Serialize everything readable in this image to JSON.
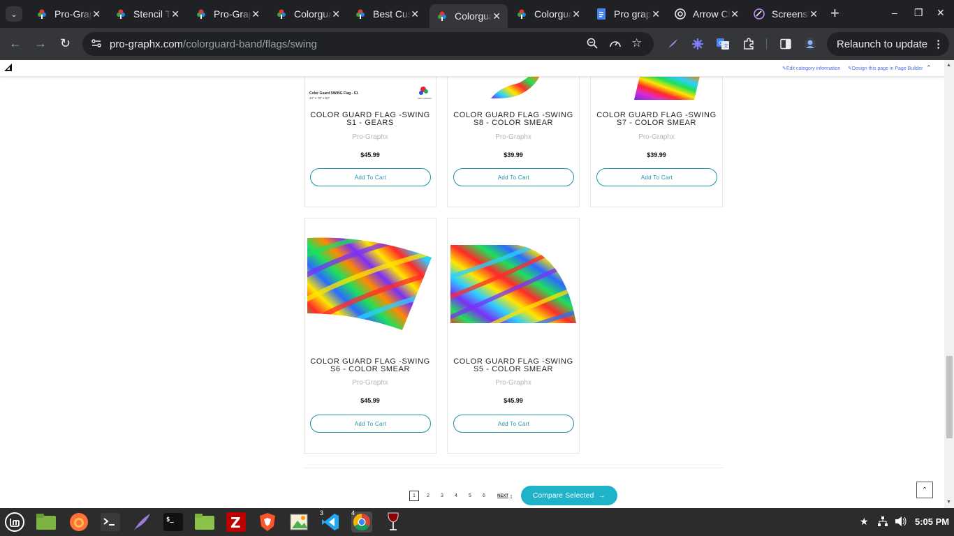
{
  "browser": {
    "tabs": [
      {
        "title": "Pro-Graphx",
        "favicon": "pro-graphx-logo-icon",
        "active": false
      },
      {
        "title": "Stencil Theme",
        "favicon": "pro-graphx-logo-icon",
        "active": false
      },
      {
        "title": "Pro-Graphx",
        "favicon": "pro-graphx-logo-icon",
        "active": false
      },
      {
        "title": "Colorguard",
        "favicon": "pro-graphx-logo-icon",
        "active": false
      },
      {
        "title": "Best Custom",
        "favicon": "pro-graphx-logo-icon",
        "active": false
      },
      {
        "title": "Colorguard",
        "favicon": "pro-graphx-logo-icon",
        "active": true
      },
      {
        "title": "Colorguard",
        "favicon": "pro-graphx-logo-icon",
        "active": false
      },
      {
        "title": "Pro graphx",
        "favicon": "google-docs-icon",
        "active": false
      },
      {
        "title": "Arrow Chat",
        "favicon": "chatgpt-icon",
        "active": false
      },
      {
        "title": "Screenshot",
        "favicon": "screenshot-tool-icon",
        "active": false
      }
    ],
    "url_host": "pro-graphx.com",
    "url_path": "/colorguard-band/flags/swing",
    "relaunch_label": "Relaunch to update"
  },
  "admin_bar": {
    "edit_category": "Edit category information",
    "page_builder": "Design this page in Page Builder"
  },
  "products": [
    {
      "name": "COLOR GUARD FLAG -SWING S1 - GEARS",
      "brand": "Pro-Graphx",
      "price": "$45.99",
      "cart_label": "Add To Cart",
      "image": "flag-s1-gears-image",
      "image_caption_title": "Color Guard SWING Flag - S1",
      "image_caption_size": "44\" x 70\" x 53\"",
      "image_logo_text": "PRO-GRAPHX"
    },
    {
      "name": "COLOR GUARD FLAG -SWING S8 - COLOR SMEAR",
      "brand": "Pro-Graphx",
      "price": "$39.99",
      "cart_label": "Add To Cart",
      "image": "flag-s8-color-smear-image"
    },
    {
      "name": "COLOR GUARD FLAG -SWING S7 - COLOR SMEAR",
      "brand": "Pro-Graphx",
      "price": "$39.99",
      "cart_label": "Add To Cart",
      "image": "flag-s7-color-smear-image"
    },
    {
      "name": "COLOR GUARD FLAG -SWING S6 - COLOR SMEAR",
      "brand": "Pro-Graphx",
      "price": "$45.99",
      "cart_label": "Add To Cart",
      "image": "flag-s6-color-smear-image"
    },
    {
      "name": "COLOR GUARD FLAG -SWING S5 - COLOR SMEAR",
      "brand": "Pro-Graphx",
      "price": "$45.99",
      "cart_label": "Add To Cart",
      "image": "flag-s5-color-smear-image"
    }
  ],
  "pagination": {
    "pages": [
      "1",
      "2",
      "3",
      "4",
      "5",
      "6"
    ],
    "current": "1",
    "next_label": "NEXT"
  },
  "compare_label": "Compare Selected",
  "taskbar": {
    "apps": [
      "linux-mint-menu-icon",
      "files-folder-icon",
      "firefox-icon",
      "terminal-icon",
      "quill-icon",
      "terminal-dark-icon",
      "file-manager-icon",
      "filezilla-icon",
      "brave-icon",
      "image-viewer-icon",
      "vscode-icon",
      "chrome-icon",
      "wine-icon"
    ],
    "vscode_badge": "3",
    "chrome_badge": "4",
    "clock": "5:05 PM"
  },
  "colors": {
    "accent": "#1fb3c9",
    "cart_border": "#1e93a8",
    "browser_dark": "#202124",
    "toolbar": "#35363a",
    "admin_link": "#4b6fd8"
  }
}
